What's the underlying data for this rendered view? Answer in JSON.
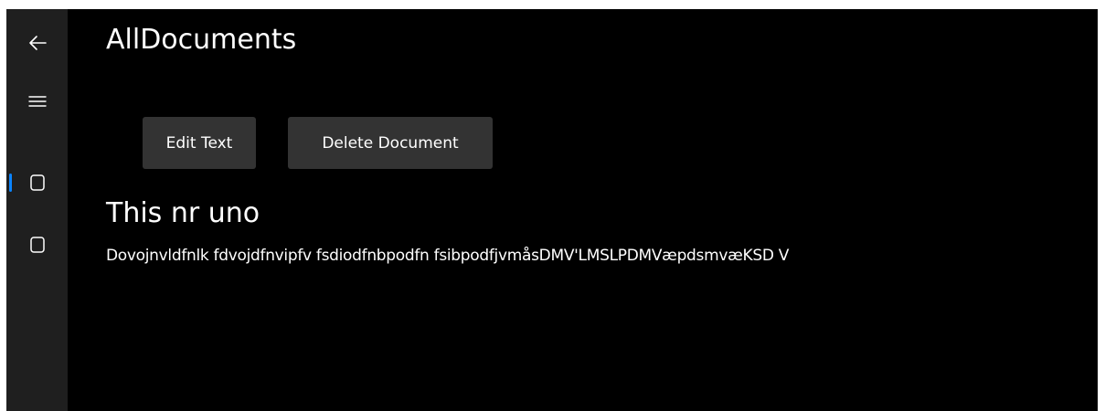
{
  "page": {
    "title": "AllDocuments"
  },
  "nav": {
    "back_icon": "back-arrow-icon",
    "menu_icon": "hamburger-menu-icon",
    "documents": [
      {
        "icon": "document-icon",
        "selected": true
      },
      {
        "icon": "document-icon",
        "selected": false
      }
    ],
    "accent_color": "#0a84ff"
  },
  "toolbar": {
    "edit_label": "Edit Text",
    "delete_label": "Delete Document"
  },
  "document": {
    "title": "This nr uno",
    "body": "Dovojnvldfnlk fdvojdfnvipfv fsdiodfnbpodfn fsibpodfjvmåsDMV'LMSLPDMVæpdsmvæKSD V"
  }
}
